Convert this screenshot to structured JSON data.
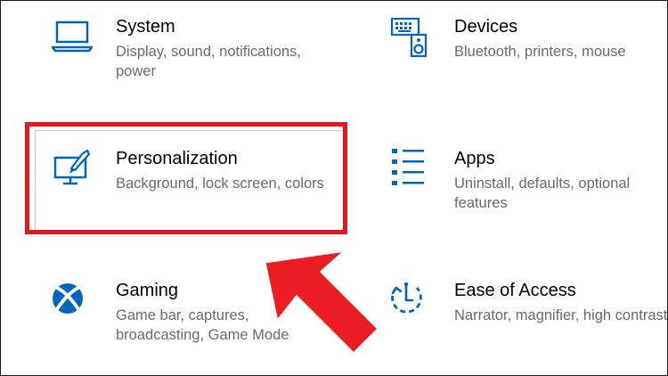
{
  "settings": {
    "tiles": [
      {
        "title": "System",
        "desc": "Display, sound, notifications, power",
        "icon": "laptop-icon"
      },
      {
        "title": "Devices",
        "desc": "Bluetooth, printers, mouse",
        "icon": "keyboard-speaker-icon"
      },
      {
        "title": "Personalization",
        "desc": "Background, lock screen, colors",
        "icon": "monitor-brush-icon"
      },
      {
        "title": "Apps",
        "desc": "Uninstall, defaults, optional features",
        "icon": "apps-list-icon"
      },
      {
        "title": "Gaming",
        "desc": "Game bar, captures, broadcasting, Game Mode",
        "icon": "xbox-icon"
      },
      {
        "title": "Ease of Access",
        "desc": "Narrator, magnifier, high contrast",
        "icon": "ease-of-access-icon"
      }
    ]
  },
  "colors": {
    "icon_blue": "#0067c0",
    "highlight_red": "#e8161c",
    "title_text": "#000000",
    "desc_text": "#6b6b6b"
  }
}
